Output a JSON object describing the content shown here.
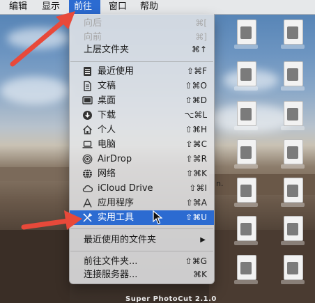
{
  "menubar": {
    "items": [
      {
        "label": "编辑"
      },
      {
        "label": "显示"
      },
      {
        "label": "前往"
      },
      {
        "label": "窗口"
      },
      {
        "label": "帮助"
      }
    ]
  },
  "go_menu": {
    "back": {
      "label": "向后",
      "shortcut": "⌘["
    },
    "forward": {
      "label": "向前",
      "shortcut": "⌘]"
    },
    "enclosing": {
      "label": "上层文件夹",
      "shortcut": "⌘↑"
    },
    "recents": {
      "label": "最近使用",
      "shortcut": "⇧⌘F"
    },
    "documents": {
      "label": "文稿",
      "shortcut": "⇧⌘O"
    },
    "desktop": {
      "label": "桌面",
      "shortcut": "⇧⌘D"
    },
    "downloads": {
      "label": "下载",
      "shortcut": "⌥⌘L"
    },
    "home": {
      "label": "个人",
      "shortcut": "⇧⌘H"
    },
    "computer": {
      "label": "电脑",
      "shortcut": "⇧⌘C"
    },
    "airdrop": {
      "label": "AirDrop",
      "shortcut": "⇧⌘R"
    },
    "network": {
      "label": "网络",
      "shortcut": "⇧⌘K"
    },
    "icloud": {
      "label": "iCloud Drive",
      "shortcut": "⇧⌘I"
    },
    "applications": {
      "label": "应用程序",
      "shortcut": "⇧⌘A"
    },
    "utilities": {
      "label": "实用工具",
      "shortcut": "⇧⌘U"
    },
    "recent_folders": {
      "label": "最近使用的文件夹",
      "arrow": "▶"
    },
    "go_to_folder": {
      "label": "前往文件夹...",
      "shortcut": "⇧⌘G"
    },
    "connect_server": {
      "label": "连接服务器...",
      "shortcut": "⌘K"
    }
  },
  "desktop": {
    "caption": "Super PhotoCut 2.1.0",
    "partial_text": "n."
  },
  "colors": {
    "highlight": "#2c6bd1",
    "arrow": "#e8493a"
  }
}
